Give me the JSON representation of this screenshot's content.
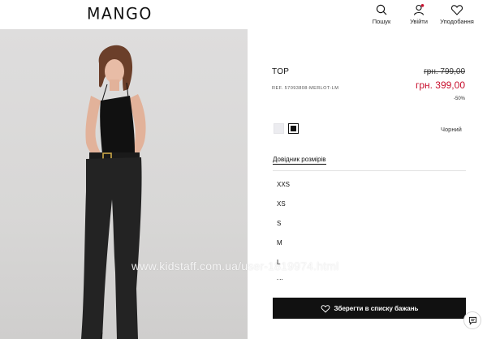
{
  "header": {
    "logo": "MANGO",
    "search_label": "Пошук",
    "login_label": "Увійти",
    "wishlist_label": "Уподобання"
  },
  "product": {
    "title": "TOP",
    "ref": "REF. 57093808-MERLOT-LM",
    "old_price": "грн. 799,00",
    "new_price": "грн. 399,00",
    "discount": "-50%",
    "color_name": "Чорний",
    "colors": [
      "#ececf0",
      "#111111"
    ],
    "size_guide": "Довідник розмірів",
    "sizes": [
      "XXS",
      "XS",
      "S",
      "M",
      "L",
      "XL"
    ],
    "wishlist_button": "Зберегти в списку бажань"
  },
  "accent_color": "#c8102e",
  "watermark": "www.kidstaff.com.ua/user-1819974.html"
}
